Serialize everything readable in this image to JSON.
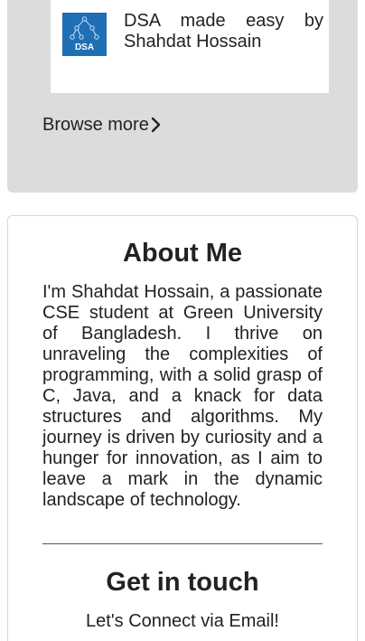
{
  "blog": {
    "post_title": "DSA made easy by Shahdat Hossain",
    "thumbnail_label": "DSA",
    "browse_more_label": "Browse more"
  },
  "about": {
    "title": "About Me",
    "text": "I'm Shahdat Hossain, a passionate CSE student at Green University of Bangladesh. I thrive on unraveling the complexities of programming, with a solid grasp of C, Java, and a knack for data structures and algorithms. My journey is driven by curiosity and a hunger for innovation, as I aim to leave a mark in the dynamic landscape of technology."
  },
  "contact": {
    "title": "Get in touch",
    "subtitle": "Let's Connect via Email!"
  },
  "colors": {
    "section_gray": "#dcdcdc",
    "thumbnail_blue": "#1f6fb5",
    "text": "#222222"
  }
}
